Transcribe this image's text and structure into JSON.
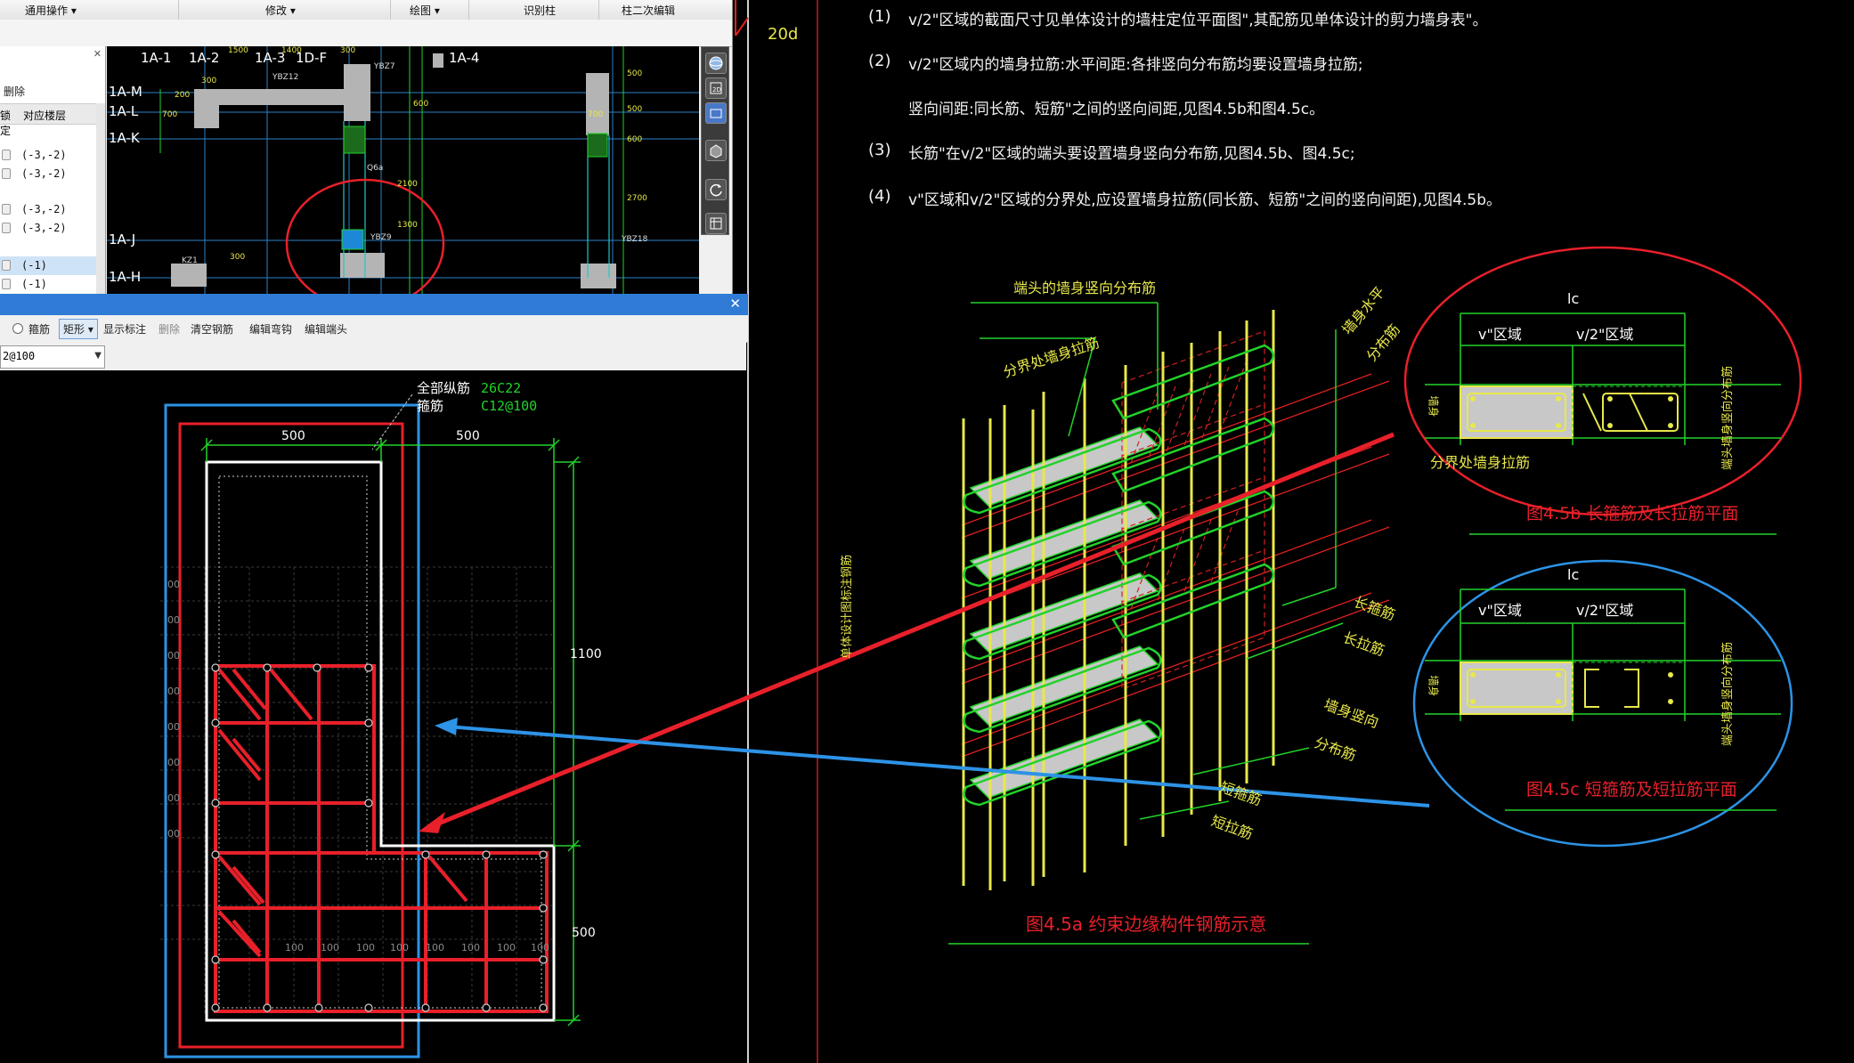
{
  "colors": {
    "background": "#000000",
    "rebar_red": "#e8202a",
    "outline_white": "#ffffff",
    "dim_green": "#22d22a",
    "rebar_yellow": "#e8e84a",
    "annot_blue": "#2d93e6",
    "title_red": "#e8202a",
    "dialog_title": "#2f7bd6"
  },
  "top_window": {
    "menu": {
      "general_ops": "通用操作",
      "modify": "修改",
      "draw": "绘图",
      "identify_column": "识别柱",
      "column_secondary_edit": "柱二次编辑"
    },
    "left_panel": {
      "delete_label": "删除",
      "col_fixed": "锁定",
      "col_floor": "对应楼层",
      "rows": [
        "(-3,-2)",
        "(-3,-2)",
        "(-3,-2)",
        "(-3,-2)",
        "(-1)",
        "(-1)"
      ]
    },
    "plan": {
      "axis_top": [
        "1A-1",
        "1A-2",
        "1A-3",
        "1D-F",
        "1A-4"
      ],
      "axis_left": [
        "1A-M",
        "1A-L",
        "1A-K",
        "1A-J",
        "1A-H"
      ],
      "labels": [
        "YBZ12",
        "YBZ7",
        "YBZ9",
        "YBZ18",
        "KZ1",
        "Q6a"
      ],
      "dims": [
        "300",
        "1500",
        "1400",
        "300",
        "500",
        "500",
        "700",
        "2700",
        "600",
        "2100",
        "1300",
        "600",
        "700",
        "200",
        "300"
      ]
    }
  },
  "dialog": {
    "tools": {
      "stirrup": "箍筋",
      "rect": "矩形",
      "show_annot": "显示标注",
      "delete": "删除",
      "clear": "清空钢筋",
      "edit_hook": "编辑弯钩",
      "edit_end": "编辑端头"
    },
    "combo_value": "2@100",
    "section": {
      "all_long_rebar_label": "全部纵筋",
      "all_long_rebar_value": "26C22",
      "stirrup_label": "箍筋",
      "stirrup_value": "C12@100",
      "dim_500_left": "500",
      "dim_500_right": "500",
      "dim_1100": "1100",
      "dim_500_vertical": "500",
      "grid_ticks": [
        "100",
        "100",
        "100",
        "100",
        "100",
        "100",
        "100",
        "100"
      ],
      "left_ticks": [
        "00",
        "00",
        "00",
        "00",
        "00",
        "00",
        "00",
        "00"
      ]
    }
  },
  "right_cad": {
    "top_fragment": "20d",
    "notes": [
      {
        "num": "(1)",
        "text": "v/2\"区域的截面尺寸见单体设计的墙柱定位平面图\",其配筋见单体设计的剪力墙身表\"。"
      },
      {
        "num": "(2)",
        "text": "v/2\"区域内的墙身拉筋:水平间距:各排竖向分布筋均要设置墙身拉筋;"
      },
      {
        "num": "",
        "text": "竖向间距:同长筋、短筋\"之间的竖向间距,见图4.5b和图4.5c。"
      },
      {
        "num": "(3)",
        "text": "长筋\"在v/2\"区域的端头要设置墙身竖向分布筋,见图4.5b、图4.5c;"
      },
      {
        "num": "(4)",
        "text": "v\"区域和v/2\"区域的分界处,应设置墙身拉筋(同长筋、短筋\"之间的竖向间距),见图4.5b。"
      }
    ],
    "iso_labels": {
      "end_vertical": "端头的墙身竖向分布筋",
      "boundary_tie": "分界处墙身拉筋",
      "wall_horizontal": "墙身水平",
      "dist_bar": "分布筋",
      "long_stirrup": "长箍筋",
      "long_tie": "长拉筋",
      "wall_vertical": "墙身竖向",
      "dist_bar2": "分布筋",
      "short_stirrup": "短箍筋",
      "short_tie": "短拉筋",
      "left_vertical": "单体设计图标注钢筋"
    },
    "fig_a_title": "图4.5a  约束边缘构件钢筋示意",
    "fig_b": {
      "lc": "lc",
      "zone1": "v\"区域",
      "zone2": "v/2\"区域",
      "boundary_label": "分界处墙身拉筋",
      "side_left": "墙身",
      "side_right": "端头墙身竖向分布筋",
      "title": "图4.5b  长箍筋及长拉筋平面"
    },
    "fig_c": {
      "lc": "lc",
      "zone1": "v\"区域",
      "zone2": "v/2\"区域",
      "side_left": "墙身",
      "side_right": "端头墙身竖向分布筋",
      "title": "图4.5c  短箍筋及短拉筋平面"
    }
  }
}
